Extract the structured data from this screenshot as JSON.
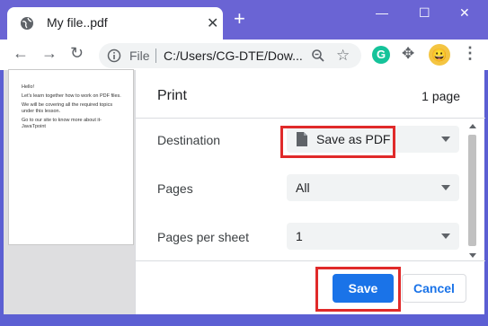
{
  "window": {
    "tab_title": "My file..pdf",
    "new_tab_label": "+",
    "minimize_label": "—",
    "maximize_label": "☐",
    "close_label": "✕"
  },
  "toolbar": {
    "back_label": "←",
    "forward_label": "→",
    "reload_label": "↻",
    "scheme": "File",
    "url": "C:/Users/CG-DTE/Dow...",
    "star_label": "☆",
    "grammarly_label": "G",
    "extensions_label": "✥",
    "avatar_label": "😀",
    "menu_label": "⋮"
  },
  "preview": {
    "lines": [
      "Hello!",
      "Let's learn together how to work on PDF files.",
      "We will be covering all the required topics under this lesson.",
      "Go to our site to know more about it- JavaTpoint"
    ]
  },
  "print": {
    "title": "Print",
    "page_count": "1 page",
    "destination_label": "Destination",
    "destination_value": "Save as PDF",
    "pages_label": "Pages",
    "pages_value": "All",
    "pages_per_sheet_label": "Pages per sheet",
    "pages_per_sheet_value": "1",
    "save_label": "Save",
    "cancel_label": "Cancel"
  },
  "colors": {
    "accent": "#1a73e8",
    "highlight": "#e02a2a",
    "titlebar": "#6a64d4"
  }
}
